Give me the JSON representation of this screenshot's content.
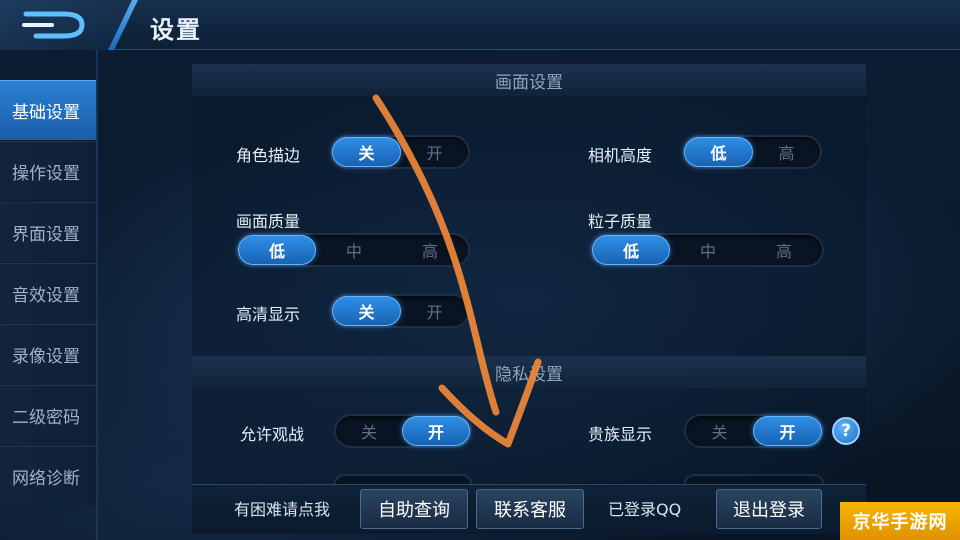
{
  "header": {
    "title": "设置"
  },
  "sidebar": {
    "items": [
      {
        "label": "基础设置",
        "active": true
      },
      {
        "label": "操作设置",
        "active": false
      },
      {
        "label": "界面设置",
        "active": false
      },
      {
        "label": "音效设置",
        "active": false
      },
      {
        "label": "录像设置",
        "active": false
      },
      {
        "label": "二级密码",
        "active": false
      },
      {
        "label": "网络诊断",
        "active": false
      }
    ]
  },
  "sections": {
    "graphics": {
      "title": "画面设置",
      "outline": {
        "label": "角色描边",
        "options": [
          "关",
          "开"
        ],
        "selected": "关"
      },
      "camera": {
        "label": "相机高度",
        "options": [
          "低",
          "高"
        ],
        "selected": "低"
      },
      "quality": {
        "label": "画面质量",
        "options": [
          "低",
          "中",
          "高"
        ],
        "selected": "低"
      },
      "particles": {
        "label": "粒子质量",
        "options": [
          "低",
          "中",
          "高"
        ],
        "selected": "低"
      },
      "hd": {
        "label": "高清显示",
        "options": [
          "关",
          "开"
        ],
        "selected": "关"
      }
    },
    "privacy": {
      "title": "隐私设置",
      "spectate": {
        "label": "允许观战",
        "options": [
          "关",
          "开"
        ],
        "selected": "开"
      },
      "noble": {
        "label": "贵族显示",
        "options": [
          "关",
          "开"
        ],
        "selected": "开"
      },
      "help_icon": "?"
    }
  },
  "footer": {
    "help_text": "有困难请点我",
    "self_service": "自助查询",
    "contact_service": "联系客服",
    "login_status": "已登录QQ",
    "logout": "退出登录"
  },
  "watermark": "京华手游网",
  "colors": {
    "accent": "#2f8ee6",
    "annotation": "#f0883a",
    "watermark": "#f7b500"
  }
}
